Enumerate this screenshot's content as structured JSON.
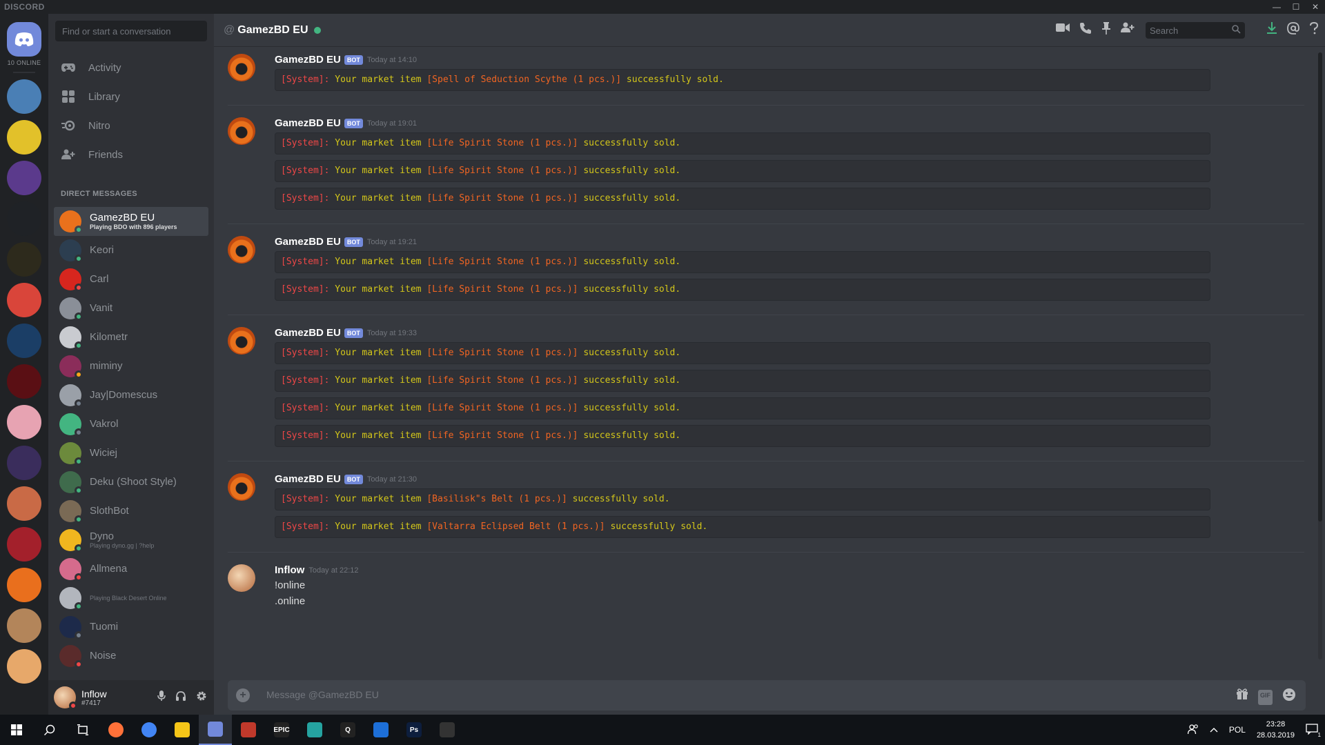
{
  "window": {
    "logo": "DISCORD",
    "minimize": "—",
    "maximize": "☐",
    "close": "✕"
  },
  "servers": {
    "online_count": "10 ONLINE",
    "items": [
      {
        "name": "server-1",
        "color": "#4a7fb5"
      },
      {
        "name": "server-2",
        "color": "#e2c12a"
      },
      {
        "name": "server-3",
        "color": "#5b3a8c"
      },
      {
        "name": "server-4",
        "color": "#1f2226"
      },
      {
        "name": "server-5",
        "color": "#2d2a1c"
      },
      {
        "name": "server-6",
        "color": "#d9453a"
      },
      {
        "name": "server-7",
        "color": "#1b3e66"
      },
      {
        "name": "server-8",
        "color": "#5a0f14"
      },
      {
        "name": "server-9",
        "color": "#e7a3b2"
      },
      {
        "name": "server-10",
        "color": "#3a2d5c"
      },
      {
        "name": "server-11",
        "color": "#c96a46"
      },
      {
        "name": "server-12",
        "color": "#a3202b"
      },
      {
        "name": "server-13",
        "color": "#e96f1d"
      },
      {
        "name": "server-14",
        "color": "#b3855a"
      },
      {
        "name": "server-15",
        "color": "#e7a86a"
      }
    ]
  },
  "sidebar": {
    "search_placeholder": "Find or start a conversation",
    "nav": [
      {
        "label": "Activity",
        "icon": "gamepad-icon"
      },
      {
        "label": "Library",
        "icon": "library-icon"
      },
      {
        "label": "Nitro",
        "icon": "nitro-icon"
      },
      {
        "label": "Friends",
        "icon": "friends-icon"
      }
    ],
    "dm_header": "DIRECT MESSAGES",
    "dms": [
      {
        "name": "GamezBD EU",
        "sub": "Playing BDO with 896 players",
        "status": "on",
        "color": "#e9711c",
        "active": true
      },
      {
        "name": "Keori",
        "sub": "",
        "status": "on",
        "color": "#2c3e50"
      },
      {
        "name": "Carl",
        "sub": "",
        "status": "dnd",
        "color": "#d7261e"
      },
      {
        "name": "Vanit",
        "sub": "",
        "status": "on",
        "color": "#8a8f98"
      },
      {
        "name": "Kilometr",
        "sub": "",
        "status": "on",
        "color": "#c9cbd0"
      },
      {
        "name": "miminy",
        "sub": "",
        "status": "idle",
        "color": "#8b2d5a"
      },
      {
        "name": "Jay|Domescus",
        "sub": "",
        "status": "off",
        "color": "#9aa0a8"
      },
      {
        "name": "Vakrol",
        "sub": "",
        "status": "off",
        "color": "#43b581"
      },
      {
        "name": "Wiciej",
        "sub": "",
        "status": "on",
        "color": "#6c8a3c"
      },
      {
        "name": "Deku (Shoot Style)",
        "sub": "",
        "status": "on",
        "color": "#3f6b4c"
      },
      {
        "name": "SlothBot",
        "sub": "",
        "status": "on",
        "color": "#7a6a55"
      },
      {
        "name": "Dyno",
        "sub": "Playing dyno.gg | ?help",
        "status": "on",
        "color": "#f0b61f"
      },
      {
        "name": "Allmena",
        "sub": "",
        "status": "dnd",
        "color": "#d56b8c"
      },
      {
        "name": "",
        "sub": "Playing Black Desert Online",
        "status": "on",
        "color": "#b2b6bd"
      },
      {
        "name": "Tuomi",
        "sub": "",
        "status": "off",
        "color": "#1d2a4a"
      },
      {
        "name": "Noise",
        "sub": "",
        "status": "dnd",
        "color": "#5a2b2b"
      }
    ],
    "user": {
      "name": "Inflow",
      "tag": "#7417"
    }
  },
  "chat": {
    "header": {
      "at": "@",
      "title": "GamezBD EU"
    },
    "search_placeholder": "Search",
    "groups": [
      {
        "author": "GamezBD EU",
        "badge": "BOT",
        "time": "Today at 14:10",
        "lines": [
          {
            "prefix": "[System]:",
            "mid": " Your market item ",
            "item": "[Spell of Seduction Scythe (1 pcs.)]",
            "end": " successfully sold."
          }
        ]
      },
      {
        "author": "GamezBD EU",
        "badge": "BOT",
        "time": "Today at 19:01",
        "lines": [
          {
            "prefix": "[System]:",
            "mid": " Your market item ",
            "item": "[Life Spirit Stone (1 pcs.)]",
            "end": " successfully sold."
          },
          {
            "prefix": "[System]:",
            "mid": " Your market item ",
            "item": "[Life Spirit Stone (1 pcs.)]",
            "end": " successfully sold."
          },
          {
            "prefix": "[System]:",
            "mid": " Your market item ",
            "item": "[Life Spirit Stone (1 pcs.)]",
            "end": " successfully sold."
          }
        ]
      },
      {
        "author": "GamezBD EU",
        "badge": "BOT",
        "time": "Today at 19:21",
        "lines": [
          {
            "prefix": "[System]:",
            "mid": " Your market item ",
            "item": "[Life Spirit Stone (1 pcs.)]",
            "end": " successfully sold."
          },
          {
            "prefix": "[System]:",
            "mid": " Your market item ",
            "item": "[Life Spirit Stone (1 pcs.)]",
            "end": " successfully sold."
          }
        ]
      },
      {
        "author": "GamezBD EU",
        "badge": "BOT",
        "time": "Today at 19:33",
        "lines": [
          {
            "prefix": "[System]:",
            "mid": " Your market item ",
            "item": "[Life Spirit Stone (1 pcs.)]",
            "end": " successfully sold."
          },
          {
            "prefix": "[System]:",
            "mid": " Your market item ",
            "item": "[Life Spirit Stone (1 pcs.)]",
            "end": " successfully sold."
          },
          {
            "prefix": "[System]:",
            "mid": " Your market item ",
            "item": "[Life Spirit Stone (1 pcs.)]",
            "end": " successfully sold."
          },
          {
            "prefix": "[System]:",
            "mid": " Your market item ",
            "item": "[Life Spirit Stone (1 pcs.)]",
            "end": " successfully sold."
          }
        ]
      },
      {
        "author": "GamezBD EU",
        "badge": "BOT",
        "time": "Today at 21:30",
        "lines": [
          {
            "prefix": "[System]:",
            "mid": " Your market item ",
            "item": "[Basilisk\"s Belt (1 pcs.)]",
            "end": " successfully sold."
          },
          {
            "prefix": "[System]:",
            "mid": " Your market item ",
            "item": "[Valtarra Eclipsed Belt (1 pcs.)]",
            "end": " successfully sold."
          }
        ]
      }
    ],
    "user_message": {
      "author": "Inflow",
      "time": "Today at 22:12",
      "lines": [
        "!online",
        ".online"
      ]
    },
    "input_placeholder": "Message @GamezBD EU",
    "gif_label": "GIF"
  },
  "taskbar": {
    "apps": [
      {
        "name": "firefox",
        "color": "#ff7139",
        "label": ""
      },
      {
        "name": "chrome",
        "color": "#4285f4",
        "label": ""
      },
      {
        "name": "explorer",
        "color": "#f5c518",
        "label": ""
      },
      {
        "name": "discord",
        "color": "#7289da",
        "label": "",
        "active": true
      },
      {
        "name": "app-a",
        "color": "#c0392b",
        "label": ""
      },
      {
        "name": "epic",
        "color": "#222222",
        "label": "EPIC"
      },
      {
        "name": "map-app",
        "color": "#25a3a0",
        "label": ""
      },
      {
        "name": "q-app",
        "color": "#222222",
        "label": "Q"
      },
      {
        "name": "app-b",
        "color": "#1d6fd8",
        "label": ""
      },
      {
        "name": "photoshop",
        "color": "#0d1e3d",
        "label": "Ps"
      },
      {
        "name": "bdo",
        "color": "#333333",
        "label": ""
      }
    ],
    "lang": "POL",
    "time": "23:28",
    "date": "28.03.2019",
    "notif_count": "1"
  }
}
